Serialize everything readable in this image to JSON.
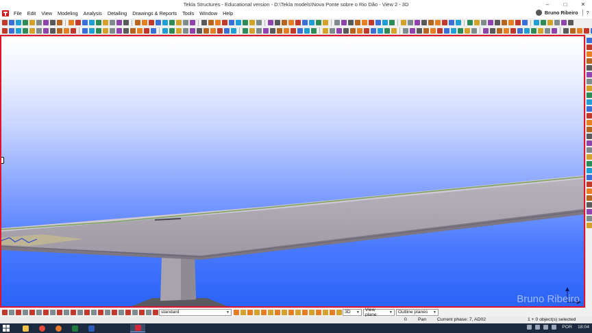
{
  "window": {
    "title": "Tekla Structures - Educational version - D:\\Tekla models\\Nova Ponte sobre o Rio Dão  - View 2 - 3D",
    "controls": [
      "–",
      "□",
      "✕"
    ]
  },
  "menu": {
    "items": [
      "File",
      "Edit",
      "View",
      "Modeling",
      "Analysis",
      "Detailing",
      "Drawings & Reports",
      "Tools",
      "Window",
      "Help"
    ],
    "user_name": "Bruno Ribeiro",
    "help_symbol": "?"
  },
  "bottom_toolbar": {
    "standard_select": "standard",
    "view_type_select": "3D",
    "view_plane_select": "View plane",
    "outline_planes_select": "Outline planes"
  },
  "status": {
    "zero": "0",
    "mode": "Pan",
    "current_phase": "Current phase: 7, AD02",
    "selection": "1 + 0 object(s) selected"
  },
  "viewport": {
    "watermark": "Bruno Ribeiro",
    "frame_color": "#e0132a"
  },
  "taskbar": {
    "language": "POR",
    "time": "18:04"
  },
  "icons": {
    "toolbar_row_1": [
      "new-icon",
      "open-icon",
      "save-icon",
      "print-icon",
      "undo-icon",
      "redo-icon",
      "cut-icon",
      "copy-icon",
      "paste-icon",
      "zoom-icon",
      "pan-icon",
      "rotate-icon",
      "select-icon",
      "snap-icon",
      "grid-icon",
      "view-icon",
      "macro-icon"
    ],
    "toolbar_row_2": [
      "beam-icon",
      "column-icon",
      "plate-icon",
      "slab-icon",
      "bolt-icon",
      "weld-icon",
      "component-icon",
      "detail-icon",
      "rebar-icon",
      "measure-icon",
      "clash-icon"
    ],
    "taskbar_apps": [
      "file-explorer-icon",
      "chrome-icon",
      "firefox-icon",
      "excel-icon",
      "word-icon",
      "tekla-icon"
    ]
  }
}
